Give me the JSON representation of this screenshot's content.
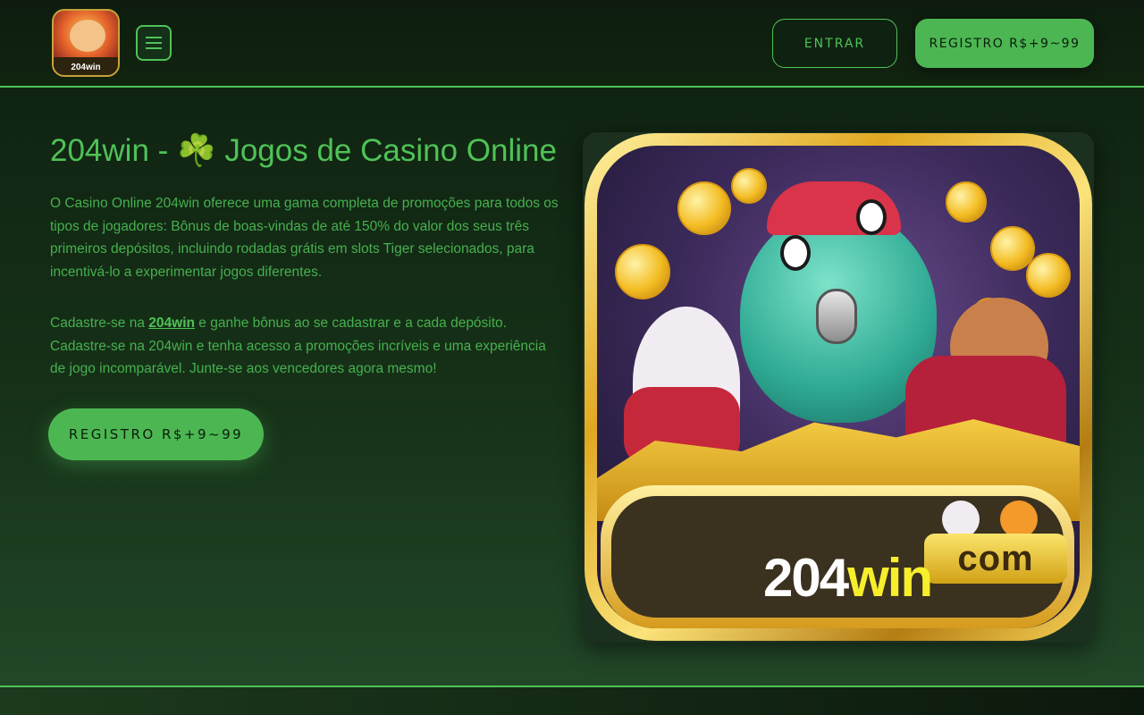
{
  "header": {
    "logo_text": "204win",
    "menu_icon": "hamburger-icon",
    "login_label": "ENTRAR",
    "register_label": "REGISTRO R$+9~99"
  },
  "main": {
    "title": "204win - ☘️ Jogos de Casino Online",
    "paragraph1": "O Casino Online 204win oferece uma gama completa de promoções para todos os tipos de jogadores: Bônus de boas-vindas de até 150% do valor dos seus três primeiros depósitos, incluindo rodadas grátis em slots Tiger selecionados, para incentivá-lo a experimentar jogos diferentes.",
    "paragraph2_prefix": "Cadastre-se na ",
    "paragraph2_link": "204win",
    "paragraph2_suffix": " e ganhe bônus ao se cadastrar e a cada depósito. Cadastre-se na 204win e tenha acesso a promoções incríveis e uma experiência de jogo incomparável. Junte-se aos vencedores agora mesmo!",
    "register_label": "REGISTRO R$+9~99"
  },
  "hero": {
    "brand_num": "204",
    "brand_win": "win",
    "brand_com": "com"
  },
  "colors": {
    "accent": "#4fc257",
    "background": "#11240f",
    "brand_yellow": "#f7ee2c"
  }
}
